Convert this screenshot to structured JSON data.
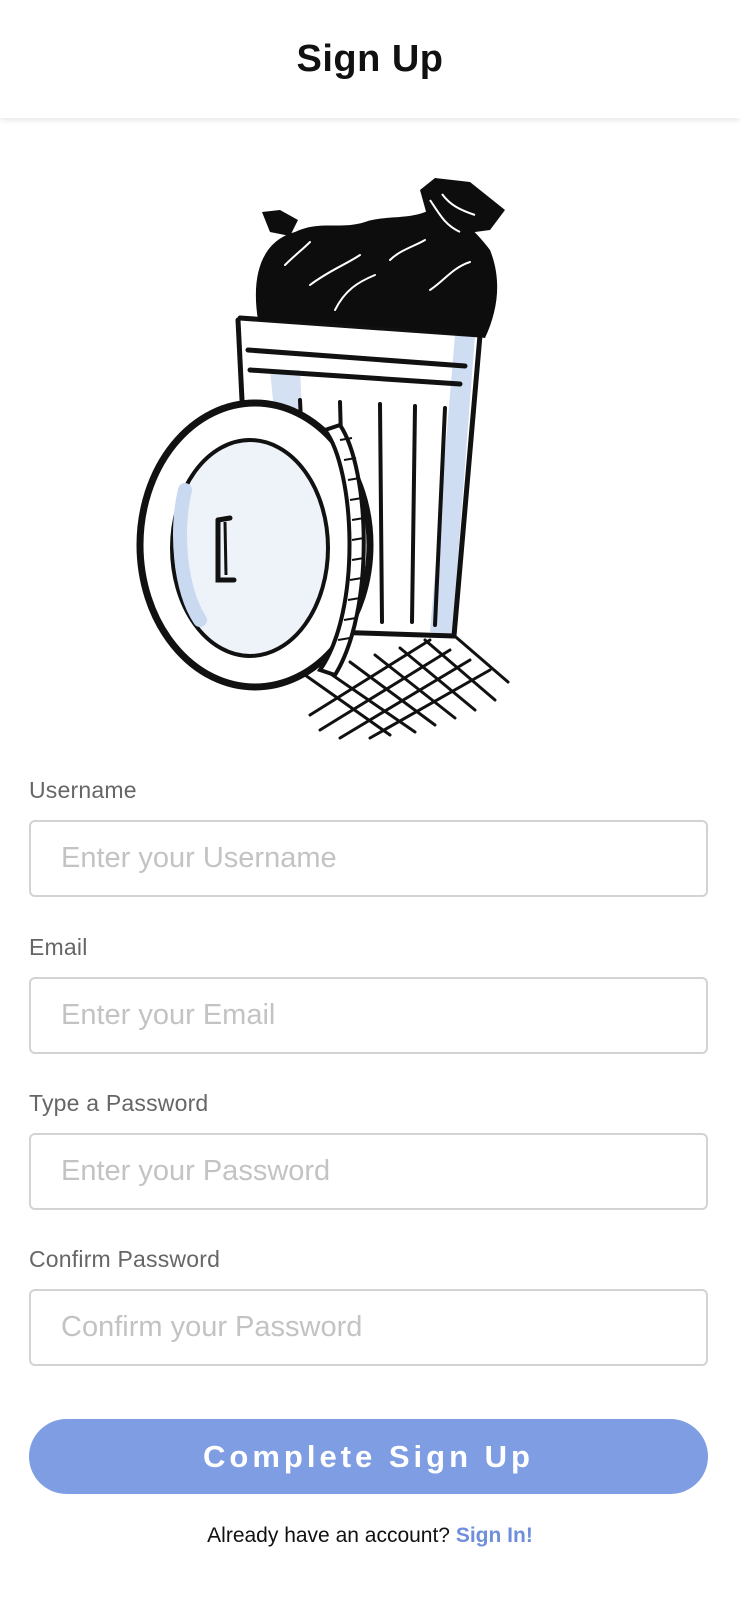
{
  "header": {
    "title": "Sign Up"
  },
  "illustration": {
    "icon": "trash-can-illustration-icon",
    "accent_color": "#c9d9ef"
  },
  "form": {
    "username": {
      "label": "Username",
      "placeholder": "Enter your Username",
      "value": ""
    },
    "email": {
      "label": "Email",
      "placeholder": "Enter your Email",
      "value": ""
    },
    "password": {
      "label": "Type a Password",
      "placeholder": "Enter your Password",
      "value": ""
    },
    "confirm": {
      "label": "Confirm Password",
      "placeholder": "Confirm your Password",
      "value": ""
    },
    "submit_label": "Complete Sign Up"
  },
  "footer": {
    "prompt": "Already have an account?",
    "link_label": "Sign In!"
  },
  "colors": {
    "primary": "#7f9de2",
    "link": "#6f8fdc",
    "input_border": "#d3d3d3"
  }
}
